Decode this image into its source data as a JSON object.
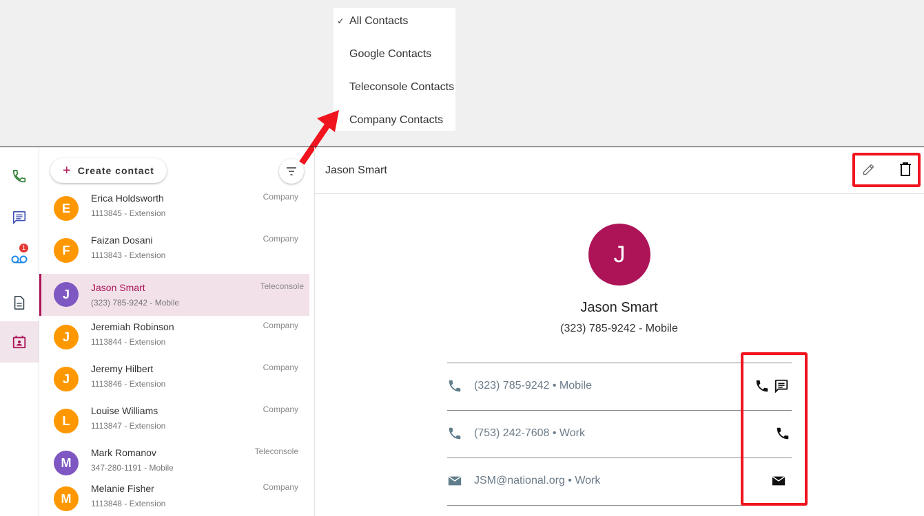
{
  "filter_menu": {
    "check_mark": "✓",
    "options": [
      "All Contacts",
      "Google Contacts",
      "Teleconsole Contacts",
      "Company Contacts"
    ],
    "selected": "All Contacts"
  },
  "rail": {
    "icons": [
      "phone-icon",
      "message-icon",
      "voicemail-icon",
      "document-icon",
      "contacts-calendar-icon"
    ],
    "voicemail_badge": "1",
    "active": "contacts-calendar-icon"
  },
  "list": {
    "create_label": "Create contact",
    "contacts": [
      {
        "initial": "E",
        "name": "Erica Holdsworth",
        "sub": "1113845 - Extension",
        "type": "Company",
        "color": "#ff9800"
      },
      {
        "initial": "F",
        "name": "Faizan Dosani",
        "sub": "1113843 - Extension",
        "type": "Company",
        "color": "#ff9800"
      },
      {
        "initial": "J",
        "name": "Jason Smart",
        "sub": "(323) 785-9242 - Mobile",
        "type": "Teleconsole",
        "color": "#7e57c2",
        "selected": true
      },
      {
        "initial": "J",
        "name": "Jeremiah Robinson",
        "sub": "1113844 - Extension",
        "type": "Company",
        "color": "#ff9800"
      },
      {
        "initial": "J",
        "name": "Jeremy Hilbert",
        "sub": "1113846 - Extension",
        "type": "Company",
        "color": "#ff9800"
      },
      {
        "initial": "L",
        "name": "Louise Williams",
        "sub": "1113847 - Extension",
        "type": "Company",
        "color": "#ff9800"
      },
      {
        "initial": "M",
        "name": "Mark Romanov",
        "sub": "347-280-1191 - Mobile",
        "type": "Teleconsole",
        "color": "#7e57c2"
      },
      {
        "initial": "M",
        "name": "Melanie Fisher",
        "sub": "1113848 - Extension",
        "type": "Company",
        "color": "#ff9800"
      }
    ]
  },
  "detail": {
    "title": "Jason Smart",
    "initial": "J",
    "name": "Jason Smart",
    "phone": "(323) 785-9242 - Mobile",
    "rows": [
      {
        "icon": "phone-icon",
        "text": "(323) 785-9242 • Mobile",
        "actions": [
          "call-icon",
          "message-icon"
        ]
      },
      {
        "icon": "phone-icon",
        "text": "(753) 242-7608 • Work",
        "actions": [
          "call-icon"
        ]
      },
      {
        "icon": "email-icon",
        "text": "JSM@national.org • Work",
        "actions": [
          "email-icon"
        ]
      }
    ]
  },
  "colors": {
    "accent": "#ad1457",
    "highlight": "#f0141e",
    "company_avatar": "#ff9800",
    "teleconsole_avatar": "#7e57c2"
  }
}
